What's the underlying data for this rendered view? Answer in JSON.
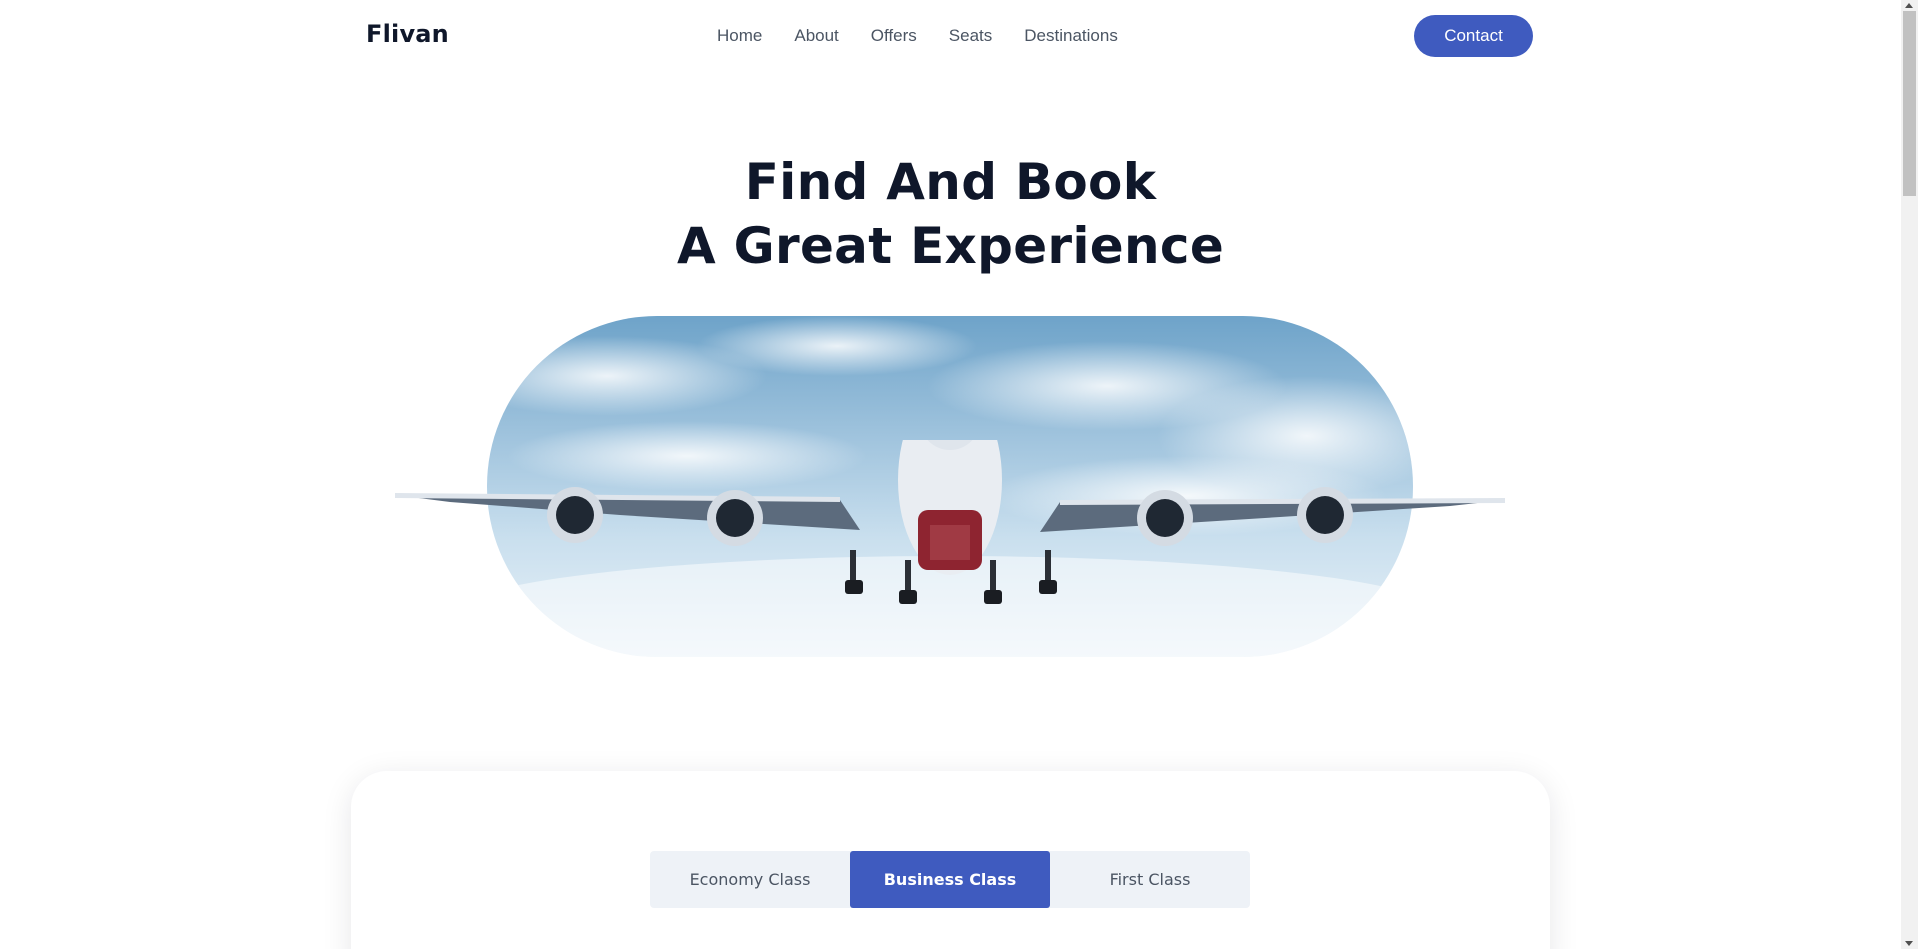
{
  "brand": {
    "logo": "Flivan"
  },
  "nav": {
    "items": [
      {
        "label": "Home"
      },
      {
        "label": "About"
      },
      {
        "label": "Offers"
      },
      {
        "label": "Seats"
      },
      {
        "label": "Destinations"
      }
    ],
    "contact_label": "Contact"
  },
  "hero": {
    "title_line1": "Find And Book",
    "title_line2": "A Great Experience"
  },
  "booking": {
    "tabs": [
      {
        "label": "Economy Class",
        "active": false
      },
      {
        "label": "Business Class",
        "active": true
      },
      {
        "label": "First Class",
        "active": false
      }
    ]
  },
  "colors": {
    "accent": "#3f5bbf",
    "heading": "#0f172a",
    "nav_text": "#4b5563",
    "tab_bg": "#eef2f7"
  },
  "icons": {
    "hero_image": "airplane-in-sky-image"
  }
}
